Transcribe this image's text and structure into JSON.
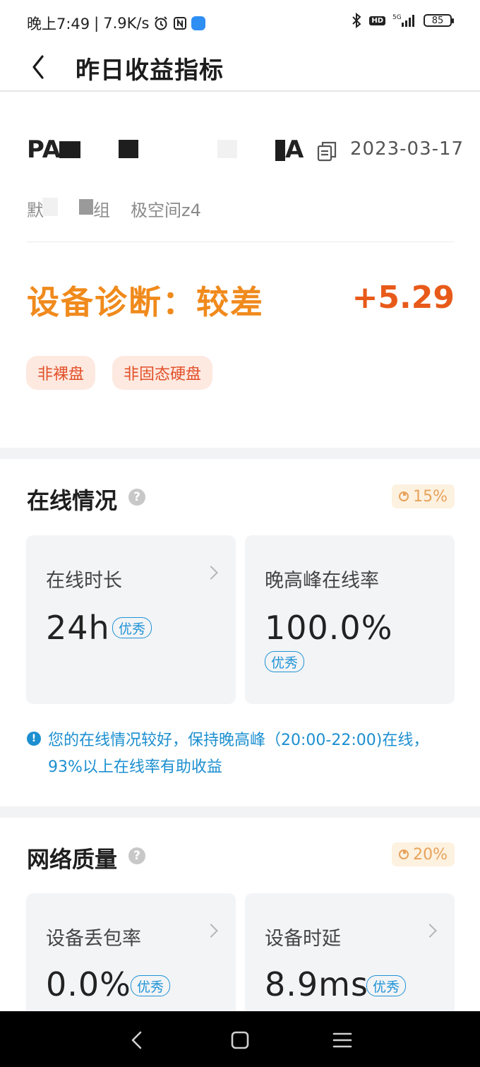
{
  "status_bar": {
    "time": "晚上7:49",
    "speed": "7.9K/s",
    "battery": "85",
    "network": "5G",
    "hd": "HD"
  },
  "header": {
    "title": "昨日收益指标"
  },
  "device": {
    "name_prefix": "PA",
    "name_suffix": "A",
    "date": "2023-03-17",
    "sub_prefix": "默",
    "sub_suffix": "组",
    "model": "极空间z4"
  },
  "diagnosis": {
    "label": "设备诊断：较差",
    "score": "+5.29",
    "tags": [
      "非裸盘",
      "非固态硬盘"
    ]
  },
  "online": {
    "title": "在线情况",
    "help": "?",
    "weight": "15%",
    "cards": [
      {
        "label": "在线时长",
        "value": "24h",
        "badge": "优秀"
      },
      {
        "label": "晚高峰在线率",
        "value": "100.0%",
        "badge": "优秀"
      }
    ],
    "tip_icon": "!",
    "tip": "您的在线情况较好，保持晚高峰（20:00-22:00)在线，93%以上在线率有助收益"
  },
  "network": {
    "title": "网络质量",
    "help": "?",
    "weight": "20%",
    "cards": [
      {
        "label": "设备丢包率",
        "value": "0.0%",
        "badge": "优秀"
      },
      {
        "label": "设备时延",
        "value": "8.9ms",
        "badge": "优秀"
      }
    ]
  },
  "colors": {
    "accent_orange": "#f08a1c",
    "score_red": "#e85a1a",
    "tag_bg": "#fde9e0",
    "info_blue": "#1f93d6"
  }
}
